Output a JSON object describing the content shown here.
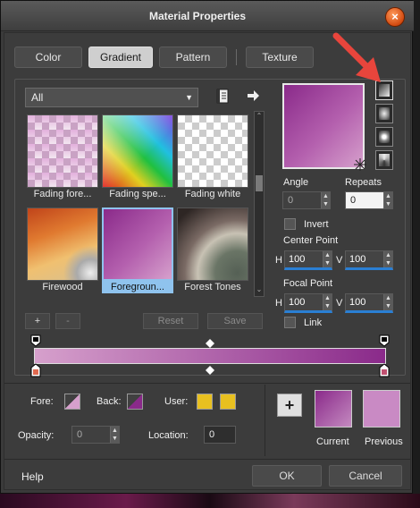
{
  "window": {
    "title": "Material Properties",
    "close_glyph": "×"
  },
  "tabs": [
    {
      "label": "Color",
      "active": false
    },
    {
      "label": "Gradient",
      "active": true
    },
    {
      "label": "Pattern",
      "active": false
    },
    {
      "label": "Texture",
      "active": false
    }
  ],
  "gradient_list": {
    "category": "All",
    "items": [
      {
        "label": "Fading fore..."
      },
      {
        "label": "Fading spe..."
      },
      {
        "label": "Fading white"
      },
      {
        "label": "Firewood"
      },
      {
        "label": "Foregroun..."
      },
      {
        "label": "Forest Tones"
      }
    ],
    "selected_index": 4
  },
  "editor_buttons": {
    "add": "+",
    "remove": "-",
    "reset": "Reset",
    "save": "Save"
  },
  "properties": {
    "angle_label": "Angle",
    "angle_value": "0",
    "repeats_label": "Repeats",
    "repeats_value": "0",
    "invert_label": "Invert",
    "center_point_label": "Center Point",
    "center_h_label": "H",
    "center_h_value": "100",
    "center_v_label": "V",
    "center_v_value": "100",
    "focal_point_label": "Focal Point",
    "focal_h_label": "H",
    "focal_h_value": "100",
    "focal_v_label": "V",
    "focal_v_value": "100",
    "link_label": "Link"
  },
  "gradient_styles": [
    "linear-style-icon",
    "rectangular-style-icon",
    "sunburst-style-icon",
    "radial-style-icon"
  ],
  "colors": {
    "gradient_start": "#d6a0cc",
    "gradient_end": "#8a2a8a",
    "current": "#9a3a9e",
    "previous": "#c98ac4",
    "user": "#e8c020",
    "accent_blue": "#2a7fd4",
    "arrow_red": "#e8453c"
  },
  "bottom": {
    "fore_label": "Fore:",
    "back_label": "Back:",
    "user_label": "User:",
    "opacity_label": "Opacity:",
    "opacity_value": "0",
    "location_label": "Location:",
    "location_value": "0",
    "add_glyph": "+",
    "current_label": "Current",
    "previous_label": "Previous"
  },
  "footer": {
    "help": "Help",
    "ok": "OK",
    "cancel": "Cancel"
  }
}
